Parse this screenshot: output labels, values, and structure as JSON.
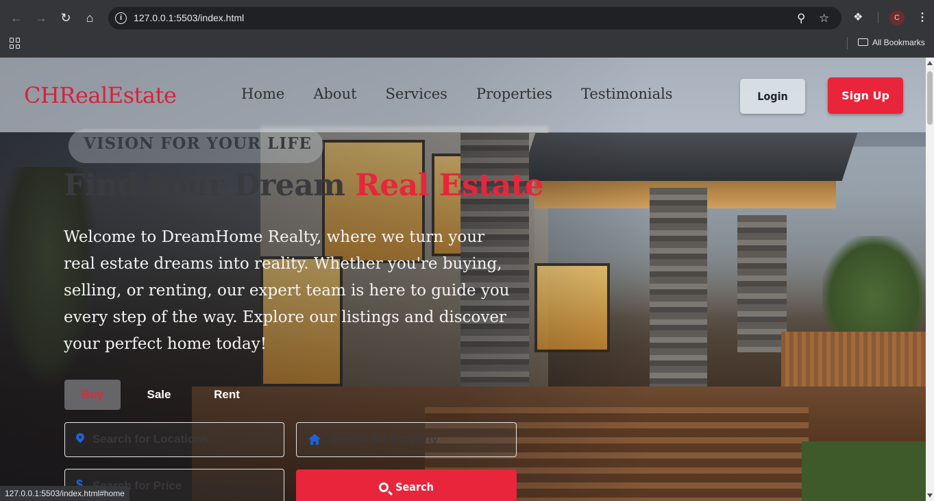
{
  "browser": {
    "url": "127.0.0.1:5503/index.html",
    "bookmarks_label": "All Bookmarks",
    "profile_initial": "C",
    "status_url": "127.0.0.1:5503/index.html#home"
  },
  "site": {
    "logo": "CHRealEstate",
    "nav": [
      "Home",
      "About",
      "Services",
      "Properties",
      "Testimonials"
    ],
    "login_label": "Login",
    "signup_label": "Sign Up"
  },
  "hero": {
    "tagline": "VISION FOR YOUR LIFE",
    "headline_plain": "Find Your Dream ",
    "headline_accent": "Real Estate",
    "intro": "Welcome to DreamHome Realty, where we turn your real estate dreams into reality. Whether you're buying, selling, or renting, our expert team is here to guide you every step of the way. Explore our listings and discover your perfect home today!"
  },
  "search": {
    "tabs": [
      "Buy",
      "Sale",
      "Rent"
    ],
    "active_tab": "Buy",
    "location_placeholder": "Search for Locations",
    "property_placeholder": "Search for Property",
    "price_placeholder": "Search for Price",
    "button_label": "Search"
  },
  "colors": {
    "accent": "#e8253b",
    "icon_blue": "#1e63d6"
  }
}
